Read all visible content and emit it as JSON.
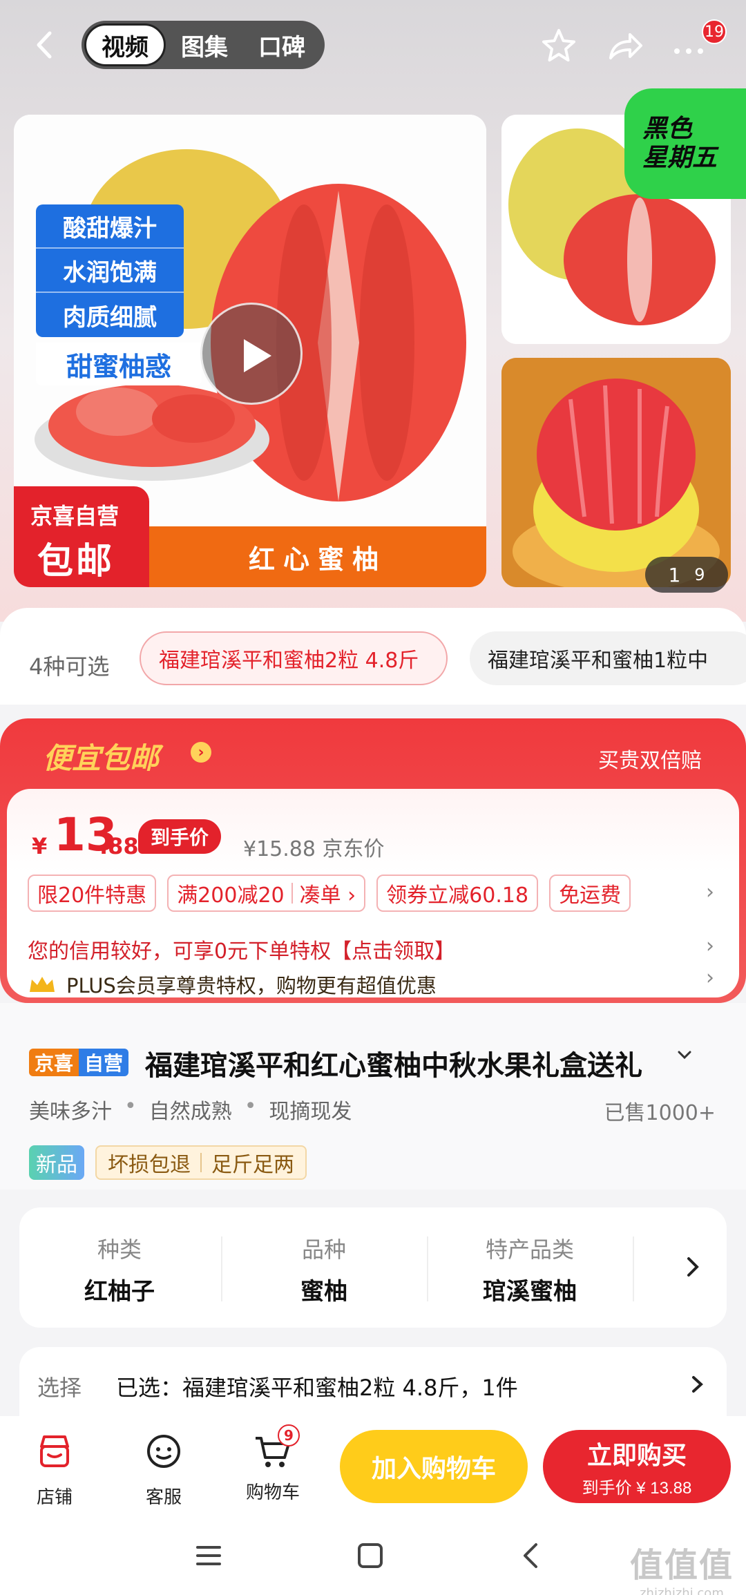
{
  "header": {
    "tabs": [
      {
        "label": "视频"
      },
      {
        "label": "图集"
      },
      {
        "label": "口碑"
      }
    ],
    "notification_count": "19"
  },
  "gallery": {
    "main_features": [
      "酸甜爆汁",
      "水润饱满",
      "肉质细腻"
    ],
    "main_slogan": "甜蜜柚惑",
    "jd_badge_line1": "京喜自营",
    "jd_badge_line2": "包邮",
    "banner_text": "红心蜜柚",
    "black_friday_line1": "黑色",
    "black_friday_line2": "星期五",
    "pager_current": "1",
    "pager_total": "9"
  },
  "variants": {
    "count_label": "4种可选",
    "items": [
      {
        "label": "福建琯溪平和蜜柚2粒 4.8斤",
        "selected": true
      },
      {
        "label": "福建琯溪平和蜜柚1粒中",
        "selected": false
      }
    ]
  },
  "promo": {
    "title": "便宜包邮",
    "right_text": "买贵双倍赔"
  },
  "price": {
    "currency": "¥",
    "integer": "13",
    "decimal": ".88",
    "tag": "到手价",
    "original": "¥15.88 京东价",
    "chips": [
      "限20件特惠",
      "满200减20",
      "凑单 ›",
      "领券立减60.18",
      "免运费"
    ],
    "credit_text": "您的信用较好，可享0元下单特权【点击领取】",
    "plus_text": "PLUS会员享尊贵特权，购物更有超值优惠"
  },
  "product": {
    "tag_a": "京喜",
    "tag_b": "自营",
    "title": "福建琯溪平和红心蜜柚中秋水果礼盒送礼",
    "attributes": [
      "美味多汁",
      "自然成熟",
      "现摘现发"
    ],
    "sold": "已售1000+",
    "new_tag": "新品",
    "guarantees": [
      "坏损包退",
      "足斤足两"
    ]
  },
  "specs": [
    {
      "key": "种类",
      "value": "红柚子"
    },
    {
      "key": "品种",
      "value": "蜜柚"
    },
    {
      "key": "特产品类",
      "value": "琯溪蜜柚"
    }
  ],
  "choose": {
    "label": "选择",
    "value": "已选：福建琯溪平和蜜柚2粒 4.8斤，1件"
  },
  "actions": {
    "store": "店铺",
    "service": "客服",
    "cart": "购物车",
    "cart_count": "9",
    "add_cart": "加入购物车",
    "buy_now": "立即购买",
    "buy_sub": "到手价 ¥ 13.88"
  },
  "watermark": {
    "big": "值值值",
    "small": "zhizhizhi.com"
  },
  "colors": {
    "brand_red": "#e3222b",
    "cart_yellow": "#ffcc1a",
    "promo_gold": "#ffd25a"
  }
}
